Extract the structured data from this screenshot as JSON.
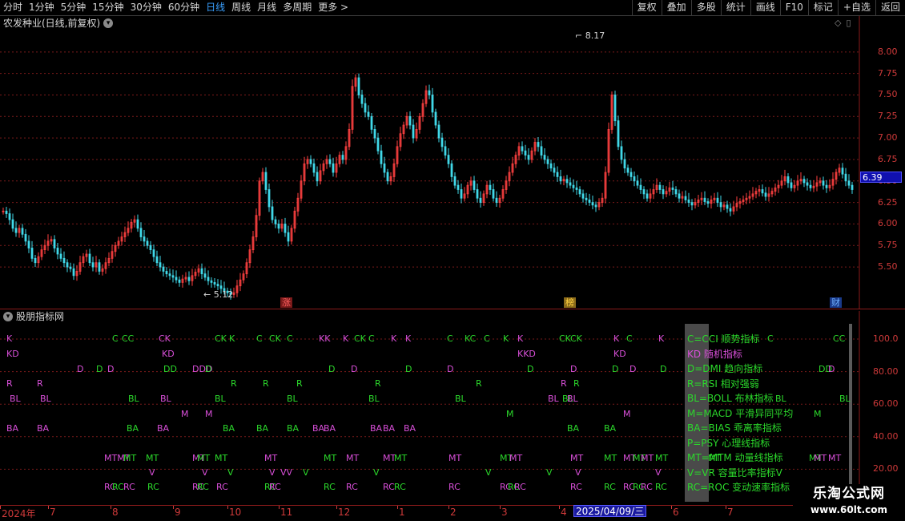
{
  "topbar": {
    "periods": [
      "分时",
      "1分钟",
      "5分钟",
      "15分钟",
      "30分钟",
      "60分钟",
      "日线",
      "周线",
      "月线",
      "多周期",
      "更多 >"
    ],
    "active_period": "日线",
    "tools": [
      "复权",
      "叠加",
      "多股",
      "统计",
      "画线",
      "F10",
      "标记",
      "+自选",
      "返回"
    ]
  },
  "price_panel": {
    "title": "农发种业(日线,前复权)",
    "y_ticks": [
      "8.00",
      "7.75",
      "7.50",
      "7.25",
      "7.00",
      "6.75",
      "6.50",
      "6.25",
      "6.00",
      "5.75",
      "5.50"
    ],
    "current_price": "6.39",
    "high_label": "8.17",
    "low_label": "5.12",
    "tag_zhang": "涨",
    "tag_bang": "榜",
    "tag_cai": "财"
  },
  "indicator_panel": {
    "title": "股朋指标网",
    "y_ticks": [
      "100.0",
      "80.00",
      "60.00",
      "40.00",
      "20.00"
    ],
    "legend": [
      {
        "text": "C=CCI 顺势指标",
        "color": "#2bd92b"
      },
      {
        "text": "KD 随机指标",
        "color": "#d94fd9"
      },
      {
        "text": "D=DMI 趋向指标",
        "color": "#2bd92b"
      },
      {
        "text": "R=RSI 相对强弱",
        "color": "#2bd92b"
      },
      {
        "text": "BL=BOLL 布林指标",
        "color": "#2bd92b"
      },
      {
        "text": "M=MACD 平滑异同平均",
        "color": "#2bd92b"
      },
      {
        "text": "BA=BIAS 乖离率指标",
        "color": "#2bd92b"
      },
      {
        "text": "P=PSY 心理线指标",
        "color": "#2bd92b"
      },
      {
        "text": "MT=MTM 动量线指标",
        "color": "#2bd92b"
      },
      {
        "text": "V=VR 容量比率指标V",
        "color": "#2bd92b"
      },
      {
        "text": "RC=ROC 变动速率指标",
        "color": "#2bd92b"
      }
    ],
    "rows": [
      {
        "y": 416,
        "items": [
          [
            8,
            "K",
            "m"
          ],
          [
            140,
            "C",
            "g"
          ],
          [
            152,
            "CC",
            "g"
          ],
          [
            198,
            "CK",
            "m"
          ],
          [
            268,
            "CK",
            "g"
          ],
          [
            286,
            "K",
            "g"
          ],
          [
            320,
            "C",
            "g"
          ],
          [
            336,
            "CK",
            "g"
          ],
          [
            358,
            "C",
            "g"
          ],
          [
            398,
            "KK",
            "m"
          ],
          [
            428,
            "K",
            "m"
          ],
          [
            442,
            "CK",
            "g"
          ],
          [
            460,
            "C",
            "g"
          ],
          [
            488,
            "K",
            "m"
          ],
          [
            506,
            "K",
            "m"
          ],
          [
            558,
            "C",
            "g"
          ],
          [
            580,
            "KC",
            "g"
          ],
          [
            604,
            "C",
            "g"
          ],
          [
            628,
            "K",
            "g"
          ],
          [
            646,
            "K",
            "m"
          ],
          [
            698,
            "CK",
            "g"
          ],
          [
            712,
            "CK",
            "g"
          ],
          [
            766,
            "K",
            "m"
          ],
          [
            782,
            "C",
            "g"
          ],
          [
            822,
            "K",
            "m"
          ],
          [
            958,
            "C",
            "g"
          ],
          [
            1040,
            "CC",
            "g"
          ]
        ]
      },
      {
        "y": 435,
        "items": [
          [
            8,
            "KD",
            "m"
          ],
          [
            202,
            "KD",
            "m"
          ],
          [
            646,
            "KKD",
            "m"
          ],
          [
            766,
            "KD",
            "m"
          ]
        ]
      },
      {
        "y": 454,
        "items": [
          [
            96,
            "D",
            "m"
          ],
          [
            120,
            "D",
            "g"
          ],
          [
            134,
            "D",
            "m"
          ],
          [
            204,
            "DD",
            "g"
          ],
          [
            240,
            "DDD",
            "m"
          ],
          [
            256,
            "D",
            "g"
          ],
          [
            410,
            "D",
            "g"
          ],
          [
            438,
            "D",
            "m"
          ],
          [
            506,
            "D",
            "g"
          ],
          [
            558,
            "D",
            "m"
          ],
          [
            658,
            "D",
            "g"
          ],
          [
            712,
            "D",
            "m"
          ],
          [
            764,
            "D",
            "g"
          ],
          [
            786,
            "D",
            "m"
          ],
          [
            824,
            "D",
            "g"
          ],
          [
            1022,
            "DD",
            "g"
          ],
          [
            1034,
            "D",
            "m"
          ]
        ]
      },
      {
        "y": 472,
        "items": [
          [
            8,
            "R",
            "m"
          ],
          [
            46,
            "R",
            "m"
          ],
          [
            288,
            "R",
            "g"
          ],
          [
            328,
            "R",
            "g"
          ],
          [
            370,
            "R",
            "g"
          ],
          [
            468,
            "R",
            "g"
          ],
          [
            594,
            "R",
            "g"
          ],
          [
            700,
            "R",
            "m"
          ],
          [
            716,
            "R",
            "g"
          ]
        ]
      },
      {
        "y": 491,
        "items": [
          [
            12,
            "BL",
            "m"
          ],
          [
            50,
            "BL",
            "m"
          ],
          [
            160,
            "BL",
            "g"
          ],
          [
            200,
            "BL",
            "m"
          ],
          [
            268,
            "BL",
            "g"
          ],
          [
            358,
            "BL",
            "g"
          ],
          [
            460,
            "BL",
            "g"
          ],
          [
            568,
            "BL",
            "g"
          ],
          [
            684,
            "BL",
            "m"
          ],
          [
            702,
            "BL",
            "g"
          ],
          [
            708,
            "BL",
            "m"
          ],
          [
            968,
            "BL",
            "g"
          ],
          [
            1048,
            "BL",
            "g"
          ]
        ]
      },
      {
        "y": 510,
        "items": [
          [
            226,
            "M",
            "m"
          ],
          [
            256,
            "M",
            "m"
          ],
          [
            632,
            "M",
            "g"
          ],
          [
            778,
            "M",
            "m"
          ],
          [
            1016,
            "M",
            "g"
          ]
        ]
      },
      {
        "y": 528,
        "items": [
          [
            8,
            "BA",
            "m"
          ],
          [
            46,
            "BA",
            "m"
          ],
          [
            158,
            "BA",
            "g"
          ],
          [
            196,
            "BA",
            "m"
          ],
          [
            278,
            "BA",
            "g"
          ],
          [
            320,
            "BA",
            "g"
          ],
          [
            358,
            "BA",
            "g"
          ],
          [
            390,
            "BA",
            "m"
          ],
          [
            404,
            "BA",
            "m"
          ],
          [
            462,
            "BA",
            "m"
          ],
          [
            478,
            "BA",
            "m"
          ],
          [
            504,
            "BA",
            "m"
          ],
          [
            708,
            "BA",
            "g"
          ],
          [
            754,
            "BA",
            "g"
          ]
        ]
      },
      {
        "y": 565,
        "items": [
          [
            130,
            "MTMT",
            "m"
          ],
          [
            154,
            "MT",
            "g"
          ],
          [
            182,
            "MT",
            "g"
          ],
          [
            240,
            "MT",
            "m"
          ],
          [
            246,
            "MT",
            "g"
          ],
          [
            268,
            "MT",
            "g"
          ],
          [
            330,
            "MT",
            "m"
          ],
          [
            404,
            "MT",
            "g"
          ],
          [
            432,
            "MT",
            "m"
          ],
          [
            478,
            "MT",
            "m"
          ],
          [
            492,
            "MT",
            "g"
          ],
          [
            560,
            "MT",
            "m"
          ],
          [
            624,
            "MT",
            "g"
          ],
          [
            636,
            "MT",
            "m"
          ],
          [
            712,
            "MT",
            "m"
          ],
          [
            754,
            "MT",
            "g"
          ],
          [
            778,
            "MT",
            "m"
          ],
          [
            790,
            "MT",
            "g"
          ],
          [
            800,
            "MT",
            "m"
          ],
          [
            818,
            "MT",
            "g"
          ],
          [
            884,
            "MT",
            "g"
          ],
          [
            1010,
            "MT",
            "g"
          ],
          [
            1016,
            "MT",
            "m"
          ],
          [
            1034,
            "MT",
            "m"
          ]
        ]
      },
      {
        "y": 583,
        "items": [
          [
            186,
            "V",
            "m"
          ],
          [
            252,
            "V",
            "m"
          ],
          [
            284,
            "V",
            "g"
          ],
          [
            336,
            "V",
            "m"
          ],
          [
            350,
            "VV",
            "m"
          ],
          [
            378,
            "V",
            "g"
          ],
          [
            466,
            "V",
            "g"
          ],
          [
            606,
            "V",
            "g"
          ],
          [
            682,
            "V",
            "g"
          ],
          [
            718,
            "V",
            "m"
          ],
          [
            818,
            "V",
            "m"
          ]
        ]
      },
      {
        "y": 601,
        "items": [
          [
            130,
            "RC",
            "m"
          ],
          [
            140,
            "RC",
            "g"
          ],
          [
            154,
            "RC",
            "m"
          ],
          [
            184,
            "RC",
            "g"
          ],
          [
            240,
            "RC",
            "m"
          ],
          [
            246,
            "RC",
            "g"
          ],
          [
            270,
            "RC",
            "m"
          ],
          [
            330,
            "RC",
            "g"
          ],
          [
            336,
            "RC",
            "m"
          ],
          [
            404,
            "RC",
            "g"
          ],
          [
            432,
            "RC",
            "m"
          ],
          [
            478,
            "RC",
            "m"
          ],
          [
            492,
            "RC",
            "g"
          ],
          [
            560,
            "RC",
            "m"
          ],
          [
            624,
            "RC",
            "m"
          ],
          [
            634,
            "RC",
            "g"
          ],
          [
            642,
            "RC",
            "m"
          ],
          [
            712,
            "RC",
            "m"
          ],
          [
            754,
            "RC",
            "g"
          ],
          [
            778,
            "RC",
            "m"
          ],
          [
            790,
            "RC",
            "g"
          ],
          [
            800,
            "RC",
            "m"
          ],
          [
            818,
            "RC",
            "g"
          ]
        ]
      }
    ]
  },
  "date_axis": {
    "labels": [
      [
        "2024年",
        2
      ],
      [
        "7",
        62
      ],
      [
        "8",
        140
      ],
      [
        "9",
        218
      ],
      [
        "10",
        286
      ],
      [
        "11",
        350
      ],
      [
        "12",
        422
      ],
      [
        "1",
        498
      ],
      [
        "2",
        562
      ],
      [
        "3",
        626
      ],
      [
        "4",
        700
      ],
      [
        "6",
        840
      ],
      [
        "7",
        908
      ]
    ],
    "highlight": "2025/04/09/三"
  },
  "watermark": {
    "title": "乐淘公式网",
    "url": "www.60lt.com"
  },
  "colors": {
    "up": "#ff4040",
    "down": "#40d8e8",
    "grid": "#7a1a1a",
    "magenta": "#d94fd9",
    "green": "#2bd92b"
  },
  "chart_data": {
    "type": "candlestick",
    "title": "农发种业(日线,前复权)",
    "ylim": [
      5.1,
      8.25
    ],
    "close": [
      6.15,
      6.12,
      6.05,
      5.95,
      5.9,
      5.95,
      5.88,
      5.8,
      5.72,
      5.6,
      5.55,
      5.62,
      5.7,
      5.75,
      5.8,
      5.82,
      5.72,
      5.65,
      5.6,
      5.55,
      5.5,
      5.48,
      5.4,
      5.45,
      5.55,
      5.62,
      5.65,
      5.55,
      5.5,
      5.55,
      5.45,
      5.48,
      5.55,
      5.6,
      5.68,
      5.75,
      5.8,
      5.85,
      5.9,
      5.95,
      6.02,
      6.05,
      5.95,
      5.85,
      5.8,
      5.75,
      5.7,
      5.62,
      5.55,
      5.5,
      5.45,
      5.42,
      5.4,
      5.38,
      5.35,
      5.32,
      5.36,
      5.38,
      5.34,
      5.4,
      5.44,
      5.48,
      5.42,
      5.38,
      5.34,
      5.32,
      5.3,
      5.28,
      5.25,
      5.22,
      5.2,
      5.18,
      5.2,
      5.28,
      5.35,
      5.42,
      5.55,
      5.7,
      5.85,
      6.1,
      6.5,
      6.6,
      6.4,
      6.2,
      6.05,
      6.0,
      5.95,
      6.0,
      5.9,
      5.8,
      5.95,
      6.15,
      6.3,
      6.5,
      6.7,
      6.75,
      6.7,
      6.6,
      6.5,
      6.62,
      6.7,
      6.75,
      6.7,
      6.6,
      6.7,
      6.8,
      6.75,
      6.9,
      7.1,
      7.6,
      7.7,
      7.5,
      7.4,
      7.3,
      7.25,
      7.1,
      7.0,
      6.85,
      6.7,
      6.6,
      6.5,
      6.55,
      6.7,
      6.9,
      7.05,
      7.15,
      7.25,
      7.15,
      7.0,
      7.1,
      7.25,
      7.4,
      7.55,
      7.5,
      7.3,
      7.15,
      7.0,
      6.9,
      6.8,
      6.7,
      6.55,
      6.45,
      6.4,
      6.3,
      6.35,
      6.45,
      6.5,
      6.4,
      6.3,
      6.25,
      6.35,
      6.45,
      6.4,
      6.3,
      6.25,
      6.3,
      6.4,
      6.5,
      6.6,
      6.7,
      6.8,
      6.9,
      6.85,
      6.8,
      6.75,
      6.85,
      6.95,
      6.9,
      6.8,
      6.75,
      6.7,
      6.65,
      6.6,
      6.55,
      6.5,
      6.52,
      6.48,
      6.45,
      6.42,
      6.4,
      6.35,
      6.3,
      6.28,
      6.25,
      6.22,
      6.2,
      6.25,
      6.3,
      6.6,
      7.1,
      7.5,
      7.2,
      6.9,
      6.75,
      6.65,
      6.6,
      6.55,
      6.5,
      6.45,
      6.4,
      6.35,
      6.3,
      6.35,
      6.4,
      6.45,
      6.4,
      6.35,
      6.38,
      6.42,
      6.4,
      6.35,
      6.3,
      6.32,
      6.28,
      6.25,
      6.22,
      6.25,
      6.28,
      6.3,
      6.26,
      6.24,
      6.28,
      6.3,
      6.25,
      6.2,
      6.22,
      6.18,
      6.15,
      6.2,
      6.24,
      6.26,
      6.28,
      6.3,
      6.32,
      6.35,
      6.38,
      6.4,
      6.36,
      6.32,
      6.35,
      6.38,
      6.42,
      6.45,
      6.5,
      6.55,
      6.48,
      6.42,
      6.45,
      6.5,
      6.52,
      6.48,
      6.45,
      6.42,
      6.44,
      6.48,
      6.5,
      6.45,
      6.42,
      6.45,
      6.52,
      6.6,
      6.65,
      6.58,
      6.5,
      6.45,
      6.4
    ]
  }
}
